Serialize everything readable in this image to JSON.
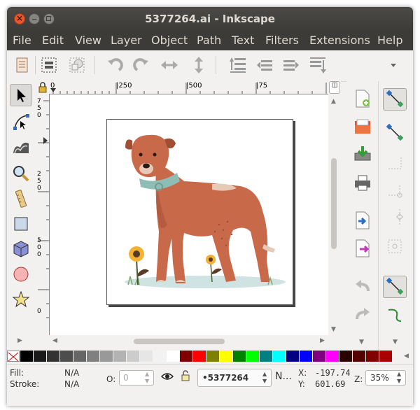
{
  "window": {
    "title": "5377264.ai - Inkscape"
  },
  "menu": [
    "File",
    "Edit",
    "View",
    "Layer",
    "Object",
    "Path",
    "Text",
    "Filters",
    "Extensions",
    "Help"
  ],
  "ruler": {
    "h_labels": [
      "0",
      "|250",
      "|500",
      "|75"
    ],
    "v_labels": [
      "7",
      "5",
      "0",
      "2",
      "5",
      "0",
      "5",
      "0",
      "0",
      "2",
      "5",
      "0",
      "0"
    ]
  },
  "palette": [
    "#000000",
    "#1a1a1a",
    "#333333",
    "#4d4d4d",
    "#666666",
    "#808080",
    "#999999",
    "#b3b3b3",
    "#cccccc",
    "#e6e6e6",
    "#f2f2f2",
    "#ffffff",
    "#800000",
    "#ff0000",
    "#808000",
    "#ffff00",
    "#008000",
    "#00ff00",
    "#008080",
    "#00ffff",
    "#000080",
    "#0000ff",
    "#800080",
    "#ff00ff",
    "#2b0000",
    "#550000",
    "#800000",
    "#aa0000"
  ],
  "status": {
    "fill_label": "Fill:",
    "fill_value": "N/A",
    "stroke_label": "Stroke:",
    "stroke_value": "N/A",
    "opacity_label": "O:",
    "opacity_value": "0",
    "layer_value": "•5377264",
    "message": "N...",
    "x_label": "X:",
    "x_value": "-197.74",
    "y_label": "Y:",
    "y_value": "601.69",
    "zoom_label": "Z:",
    "zoom_value": "35%"
  },
  "colors": {
    "menubar": "#3c3b37",
    "accent": "#e9582c",
    "dog": "#c8694a",
    "collar": "#8fbdb5"
  }
}
